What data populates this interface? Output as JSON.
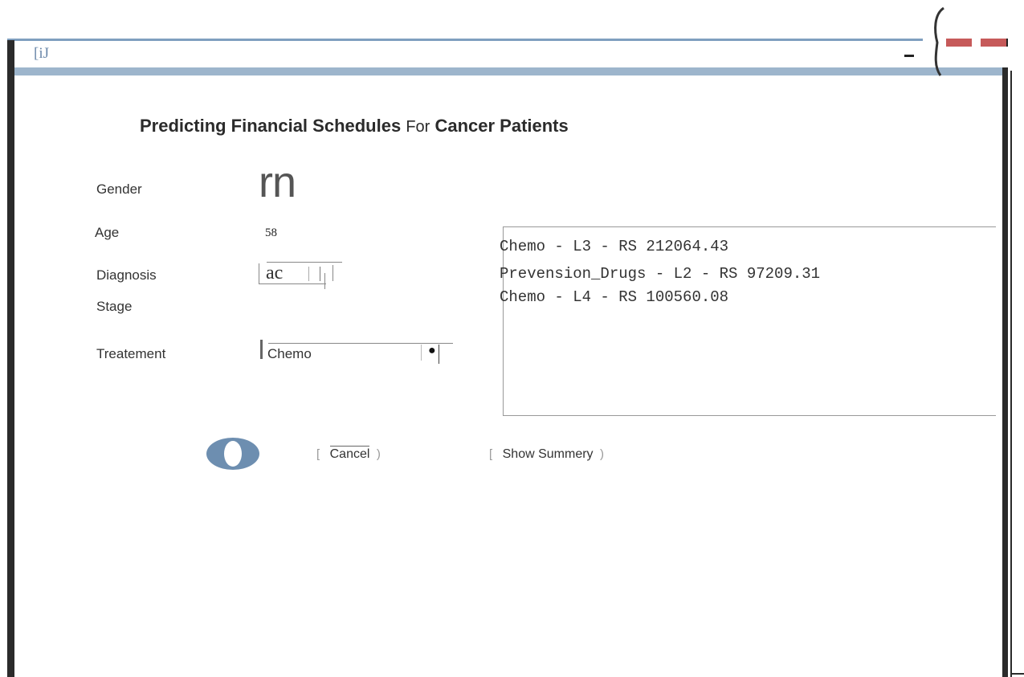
{
  "window": {
    "title_text": "[iJ"
  },
  "form": {
    "title_part1": "Predicting Financial Schedules",
    "title_for": "For",
    "title_part2": "Cancer Patients",
    "gender_label": "Gender",
    "gender_value": "rn",
    "age_label": "Age",
    "age_value": "58",
    "diagnosis_label": "Diagnosis",
    "diagnosis_value": "ac",
    "stage_label": "Stage",
    "treatment_label": "Treatement",
    "treatment_value": "Chemo"
  },
  "output": {
    "lines": [
      "Chemo - L3 - RS 212064.43",
      "Prevension_Drugs - L2 - RS 97209.31",
      "Chemo - L4 - RS 100560.08"
    ]
  },
  "buttons": {
    "cancel_label": "Cancel",
    "summary_label": "Show Summery"
  },
  "colors": {
    "titlebar": "#7f9fbf",
    "close_red": "#c65a5a",
    "ok_blue": "#6d8eb0"
  }
}
